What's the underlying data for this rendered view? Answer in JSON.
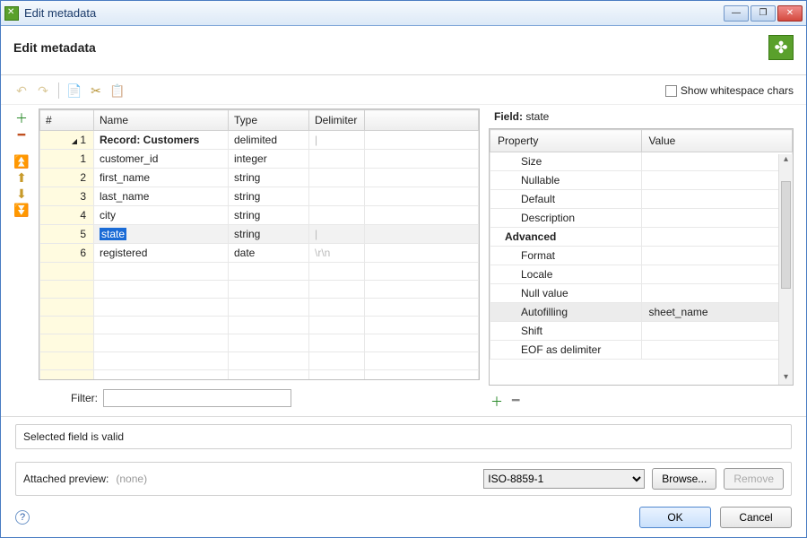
{
  "window": {
    "title": "Edit metadata"
  },
  "header": {
    "title": "Edit metadata"
  },
  "toolbar": {
    "show_ws_label": "Show whitespace chars"
  },
  "cols": {
    "num": "#",
    "name": "Name",
    "type": "Type",
    "delim": "Delimiter"
  },
  "rows": [
    {
      "num": "1",
      "name": "Record: Customers",
      "type": "delimited",
      "delim": "|",
      "record": true
    },
    {
      "num": "1",
      "name": "customer_id",
      "type": "integer",
      "delim": ""
    },
    {
      "num": "2",
      "name": "first_name",
      "type": "string",
      "delim": ""
    },
    {
      "num": "3",
      "name": "last_name",
      "type": "string",
      "delim": ""
    },
    {
      "num": "4",
      "name": "city",
      "type": "string",
      "delim": ""
    },
    {
      "num": "5",
      "name": "state",
      "type": "string",
      "delim": "|",
      "selected": true
    },
    {
      "num": "6",
      "name": "registered",
      "type": "date",
      "delim": "\\r\\n"
    }
  ],
  "filter": {
    "label": "Filter:",
    "value": ""
  },
  "field_panel": {
    "label": "Field:",
    "name": "state",
    "col_property": "Property",
    "col_value": "Value",
    "rows": [
      {
        "k": "Size",
        "v": "",
        "indent": true
      },
      {
        "k": "Nullable",
        "v": "",
        "indent": true
      },
      {
        "k": "Default",
        "v": "",
        "indent": true
      },
      {
        "k": "Description",
        "v": "",
        "indent": true
      },
      {
        "k": "Advanced",
        "v": "",
        "section": true
      },
      {
        "k": "Format",
        "v": "",
        "indent": true
      },
      {
        "k": "Locale",
        "v": "",
        "indent": true
      },
      {
        "k": "Null value",
        "v": "",
        "indent": true
      },
      {
        "k": "Autofilling",
        "v": "sheet_name",
        "indent": true,
        "auto": true
      },
      {
        "k": "Shift",
        "v": "",
        "indent": true
      },
      {
        "k": "EOF as delimiter",
        "v": "",
        "indent": true
      }
    ]
  },
  "status": {
    "text": "Selected field is valid"
  },
  "preview": {
    "label": "Attached preview:",
    "value": "(none)",
    "encoding": "ISO-8859-1",
    "browse": "Browse...",
    "remove": "Remove"
  },
  "footer": {
    "ok": "OK",
    "cancel": "Cancel"
  }
}
